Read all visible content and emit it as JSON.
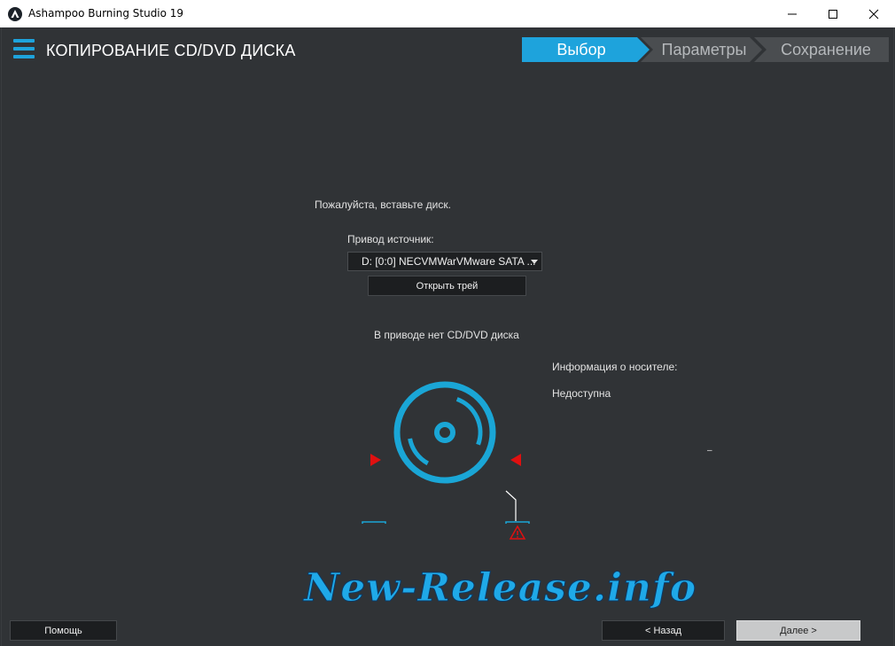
{
  "window": {
    "title": "Ashampoo Burning Studio 19"
  },
  "header": {
    "page_title": "КОПИРОВАНИЕ CD/DVD ДИСКА",
    "steps": [
      {
        "label": "Выбор",
        "active": true
      },
      {
        "label": "Параметры",
        "active": false
      },
      {
        "label": "Сохранение",
        "active": false
      }
    ]
  },
  "content": {
    "prompt": "Пожалуйста, вставьте диск.",
    "source_drive_label": "Привод источник:",
    "source_drive_value": "D: [0:0] NECVMWarVMware SATA ...",
    "open_tray_button": "Открыть трей",
    "no_disc_text": "В приводе нет CD/DVD диска",
    "media_info_label": "Информация о носителе:",
    "media_info_value": "Недоступна",
    "dash": "–"
  },
  "footer": {
    "help_button": "Помощь",
    "back_button": "< Назад",
    "next_button": "Далее >"
  },
  "watermark": "New-Release.info",
  "colors": {
    "accent": "#1ea3dc",
    "background": "#303336",
    "warning": "#e01010"
  },
  "icons": {
    "app": "ashampoo-logo-icon",
    "menu": "hamburger-icon",
    "disc": "disc-icon",
    "warning": "warning-icon"
  }
}
